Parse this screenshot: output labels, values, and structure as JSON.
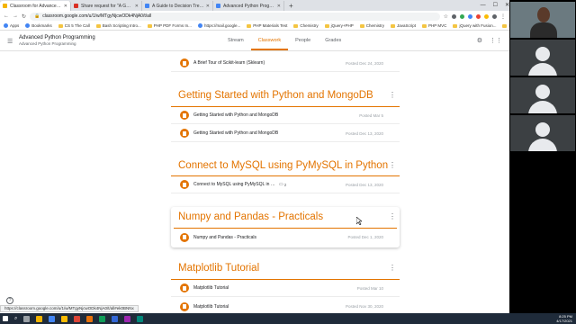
{
  "browser": {
    "tabs": [
      {
        "label": "Classroom for Advanced Python",
        "active": true,
        "color": "#f4b400"
      },
      {
        "label": "Share request for \"A Guide to D...",
        "active": false,
        "color": "#d93025"
      },
      {
        "label": "A Guide to Decision Trees for Ma...",
        "active": false,
        "color": "#4285f4"
      },
      {
        "label": "Advanced Python Programming",
        "active": false,
        "color": "#4285f4"
      }
    ],
    "new_tab": "+",
    "url": "classroom.google.com/u/1/w/MTgyNjcwODk4NjA0/t/all",
    "bookmarks": [
      {
        "label": "Apps",
        "kind": "site"
      },
      {
        "label": "Bookmarks",
        "kind": "site"
      },
      {
        "label": "CS 5 The Call",
        "kind": "folder"
      },
      {
        "label": "Bash Scripting Intro...",
        "kind": "folder"
      },
      {
        "label": "PHP PDF Forms In...",
        "kind": "folder"
      },
      {
        "label": "https://mail.google...",
        "kind": "site"
      },
      {
        "label": "PHP Materials Test",
        "kind": "folder"
      },
      {
        "label": "Chemistry",
        "kind": "folder"
      },
      {
        "label": "jQuery+PHP",
        "kind": "folder"
      },
      {
        "label": "Chemistry",
        "kind": "folder"
      },
      {
        "label": "JavaScript",
        "kind": "folder"
      },
      {
        "label": "PHP MVC",
        "kind": "folder"
      },
      {
        "label": "jQuery with Fusion...",
        "kind": "folder"
      },
      {
        "label": "Perl",
        "kind": "folder"
      }
    ]
  },
  "classroom": {
    "title": "Advanced Python Programming",
    "subtitle": "Advanced Python Programming",
    "tabs": [
      {
        "label": "Stream",
        "active": false
      },
      {
        "label": "Classwork",
        "active": true
      },
      {
        "label": "People",
        "active": false
      },
      {
        "label": "Grades",
        "active": false
      }
    ]
  },
  "content": {
    "top_item": {
      "label": "A Brief Tour of Scikit-learn (Sklearn)",
      "date": "Posted Dec 24, 2020"
    },
    "topics": [
      {
        "title": "Getting Started with Python and MongoDB",
        "items": [
          {
            "label": "Getting Started with Python and MongoDB",
            "date": "Posted Mar 5",
            "comments": ""
          },
          {
            "label": "Getting Started with Python and MongoDB",
            "date": "Posted Dec 13, 2020",
            "comments": ""
          }
        ]
      },
      {
        "title": "Connect to MySQL using PyMySQL in Python",
        "items": [
          {
            "label": "Connect to MySQL using PyMySQL in P...",
            "date": "Posted Dec 13, 2020",
            "comments": "2"
          }
        ]
      },
      {
        "title": "Numpy and Pandas - Practicals",
        "items": [
          {
            "label": "Numpy and Pandas - Practicals",
            "date": "Posted Dec 1, 2020",
            "comments": ""
          }
        ]
      },
      {
        "title": "Matplotlib Tutorial",
        "items": [
          {
            "label": "Matplotlib Tutorial",
            "date": "Posted Mar 10",
            "comments": ""
          },
          {
            "label": "Matplotlib Tutorial",
            "date": "Posted Nov 30, 2020",
            "comments": ""
          }
        ]
      }
    ]
  },
  "status_url": "https://classroom.google.com/u/1/w/MTgyNjcwODk4NjA0/t/all#ek0BNNx",
  "taskbar": {
    "time": "8:25 PM",
    "date": "4/17/2021"
  },
  "colors": {
    "accent": "#e37400",
    "taskbar": "#1f2b3a"
  }
}
